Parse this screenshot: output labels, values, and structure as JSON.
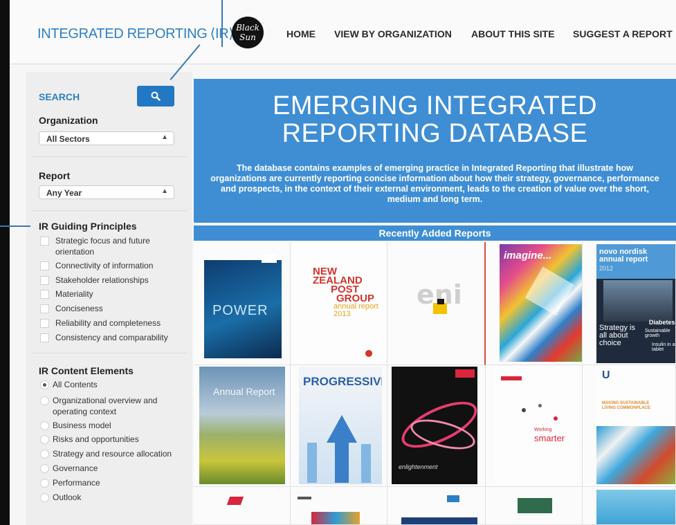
{
  "header": {
    "logo_text": "INTEGRATED REPORTING",
    "logo_ir": "⟨IR⟩",
    "badge_text": "Black Sun",
    "nav": [
      "HOME",
      "VIEW BY ORGANIZATION",
      "ABOUT THIS SITE",
      "SUGGEST A REPORT"
    ]
  },
  "sidebar": {
    "search_label": "SEARCH",
    "search_icon": "search-icon",
    "organization_title": "Organization",
    "organization_value": "All Sectors",
    "report_title": "Report",
    "report_value": "Any Year",
    "principles_title": "IR Guiding Principles",
    "principles": [
      "Strategic focus and future orientation",
      "Connectivity of information",
      "Stakeholder relationships",
      "Materiality",
      "Conciseness",
      "Reliability and completeness",
      "Consistency and comparability"
    ],
    "elements_title": "IR Content Elements",
    "elements": [
      "All Contents",
      "Organizational overview and operating context",
      "Business model",
      "Risks and opportunities",
      "Strategy and resource allocation",
      "Governance",
      "Performance",
      "Outlook"
    ],
    "selected_element": "All Contents"
  },
  "main": {
    "banner_line1": "EMERGING INTEGRATED",
    "banner_line2": "REPORTING DATABASE",
    "banner_desc": "The database contains examples of emerging practice in Integrated Reporting that illustrate how organizations are currently reporting concise information about how their strategy, governance, performance and prospects, in the context of their external environment, leads to the creation of value over the short, medium and long term.",
    "recent_title": "Recently Added Reports"
  },
  "covers": {
    "power": "POWER",
    "nzpost": [
      "NEW",
      "ZEALAND",
      "POST",
      "GROUP",
      "annual",
      "report",
      "2013"
    ],
    "eni": "eni",
    "imagine": "imagine...",
    "novo_title": "novo nordisk",
    "novo_sub": "annual report",
    "novo_year": "2012",
    "novo_strategy": "Strategy is all about choice",
    "novo_diabetes": "Diabetes",
    "novo_growth": "Sustainable growth",
    "novo_insulin": "Insulin in a tablet",
    "annual_report": "Annual Report",
    "progressive": "PROGRESSIVE",
    "enlightenment": "enlightenment",
    "smarter_small": "Working",
    "smarter": "smarter",
    "unilever_logo": "U",
    "unilever_text": "MAKING SUSTAINABLE LIVING COMMONPLACE"
  },
  "colors": {
    "accent": "#2d7fc1",
    "banner": "#3f8ed4",
    "search_button": "#2378c4"
  }
}
